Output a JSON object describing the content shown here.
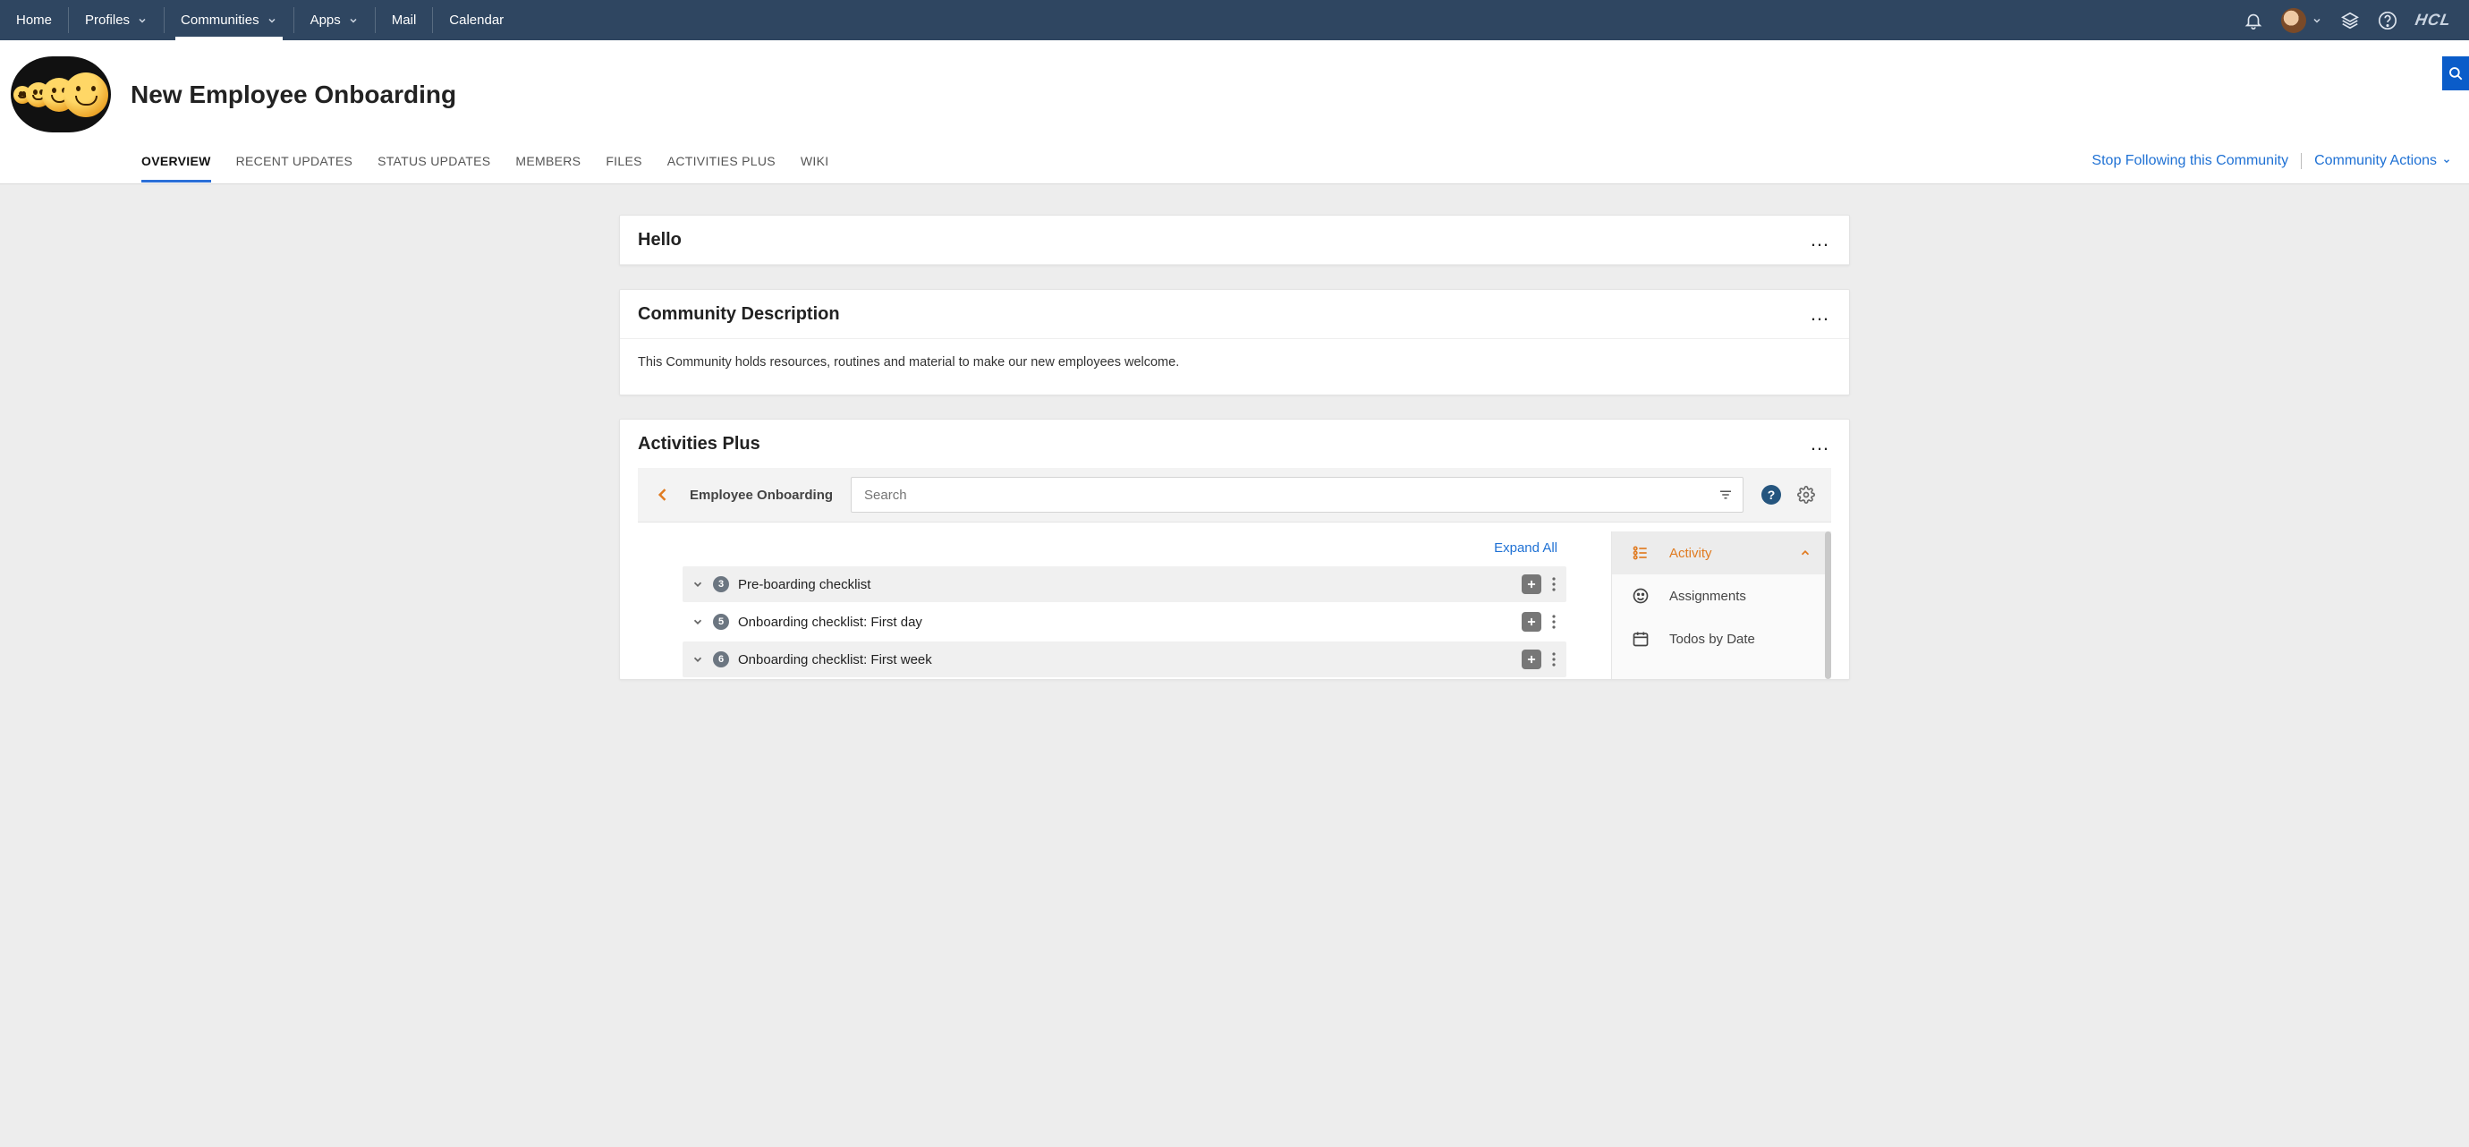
{
  "topnav": {
    "items": [
      {
        "label": "Home",
        "dropdown": false
      },
      {
        "label": "Profiles",
        "dropdown": true
      },
      {
        "label": "Communities",
        "dropdown": true,
        "active": true
      },
      {
        "label": "Apps",
        "dropdown": true
      },
      {
        "label": "Mail",
        "dropdown": false
      },
      {
        "label": "Calendar",
        "dropdown": false
      }
    ],
    "logo": "HCL"
  },
  "community": {
    "title": "New Employee Onboarding",
    "tabs": [
      {
        "label": "OVERVIEW",
        "active": true
      },
      {
        "label": "RECENT UPDATES"
      },
      {
        "label": "STATUS UPDATES"
      },
      {
        "label": "MEMBERS"
      },
      {
        "label": "FILES"
      },
      {
        "label": "ACTIVITIES PLUS"
      },
      {
        "label": "WIKI"
      }
    ],
    "actions": {
      "stop_follow": "Stop Following this Community",
      "comm_actions": "Community Actions"
    }
  },
  "widgets": {
    "hello_title": "Hello",
    "desc_title": "Community Description",
    "desc_text": "This Community holds resources, routines and material to make our new employees welcome.",
    "ap_title": "Activities Plus"
  },
  "ap": {
    "crumb": "Employee Onboarding",
    "search_placeholder": "Search",
    "expand_all": "Expand All",
    "rows": [
      {
        "count": "3",
        "title": "Pre-boarding checklist",
        "alt": true
      },
      {
        "count": "5",
        "title": "Onboarding checklist: First day",
        "alt": false
      },
      {
        "count": "6",
        "title": "Onboarding checklist: First week",
        "alt": true
      }
    ],
    "side": [
      {
        "label": "Activity",
        "icon": "activity-icon",
        "active": true,
        "collapse": true
      },
      {
        "label": "Assignments",
        "icon": "face-icon"
      },
      {
        "label": "Todos by Date",
        "icon": "calendar-icon"
      }
    ]
  }
}
